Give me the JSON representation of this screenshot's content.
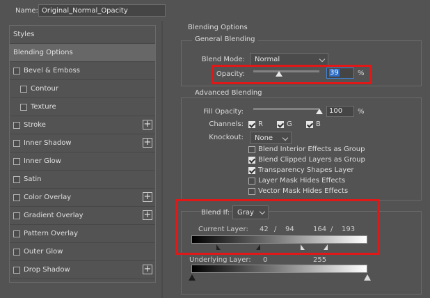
{
  "name": {
    "label": "Name:",
    "value": "Original_Normal_Opacity"
  },
  "styles_panel": {
    "items": [
      {
        "label": "Styles",
        "checkbox": false,
        "plus": false
      },
      {
        "label": "Blending Options",
        "checkbox": false,
        "plus": false,
        "selected": true
      },
      {
        "label": "Bevel & Emboss",
        "checkbox": true,
        "plus": false
      },
      {
        "label": "Contour",
        "checkbox": true,
        "plus": false,
        "indent": true
      },
      {
        "label": "Texture",
        "checkbox": true,
        "plus": false,
        "indent": true
      },
      {
        "label": "Stroke",
        "checkbox": true,
        "plus": true
      },
      {
        "label": "Inner Shadow",
        "checkbox": true,
        "plus": true
      },
      {
        "label": "Inner Glow",
        "checkbox": true,
        "plus": false
      },
      {
        "label": "Satin",
        "checkbox": true,
        "plus": false
      },
      {
        "label": "Color Overlay",
        "checkbox": true,
        "plus": true
      },
      {
        "label": "Gradient Overlay",
        "checkbox": true,
        "plus": true
      },
      {
        "label": "Pattern Overlay",
        "checkbox": true,
        "plus": false
      },
      {
        "label": "Outer Glow",
        "checkbox": true,
        "plus": false
      },
      {
        "label": "Drop Shadow",
        "checkbox": true,
        "plus": true
      }
    ],
    "plus_symbol": "+"
  },
  "blending_options": {
    "title": "Blending Options",
    "general": {
      "title": "General Blending",
      "blend_mode_label": "Blend Mode:",
      "blend_mode_value": "Normal",
      "opacity_label": "Opacity:",
      "opacity_value": "39",
      "opacity_fraction": 0.39,
      "percent": "%"
    },
    "advanced": {
      "title": "Advanced Blending",
      "fill_opacity_label": "Fill Opacity:",
      "fill_opacity_value": "100",
      "fill_opacity_fraction": 1.0,
      "percent": "%",
      "channels_label": "Channels:",
      "channels": [
        {
          "label": "R",
          "checked": true
        },
        {
          "label": "G",
          "checked": true
        },
        {
          "label": "B",
          "checked": true
        }
      ],
      "knockout_label": "Knockout:",
      "knockout_value": "None",
      "options": [
        {
          "label": "Blend Interior Effects as Group",
          "checked": false
        },
        {
          "label": "Blend Clipped Layers as Group",
          "checked": true
        },
        {
          "label": "Transparency Shapes Layer",
          "checked": true
        },
        {
          "label": "Layer Mask Hides Effects",
          "checked": false
        },
        {
          "label": "Vector Mask Hides Effects",
          "checked": false
        }
      ]
    },
    "blend_if": {
      "label": "Blend If:",
      "value": "Gray",
      "current_layer_label": "Current Layer:",
      "current_black_low": "42",
      "current_black_high": "94",
      "current_white_low": "164",
      "current_white_high": "193",
      "separator": "/",
      "underlying_layer_label": "Underlying Layer:",
      "underlying_low": "0",
      "underlying_high": "255"
    }
  },
  "colors": {
    "highlight_box": "#e01818",
    "focus": "#3c84d6"
  }
}
